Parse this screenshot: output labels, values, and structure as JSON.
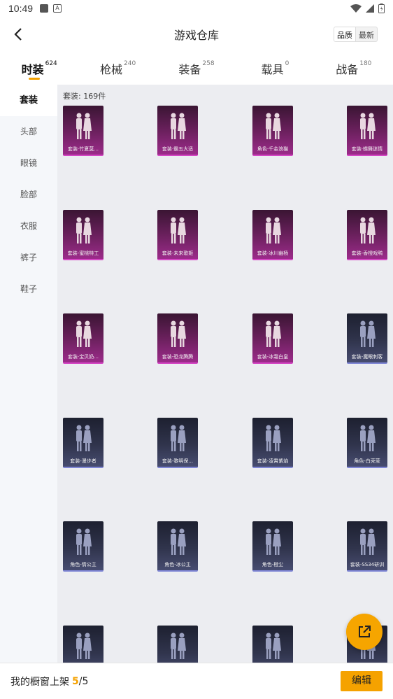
{
  "status_bar": {
    "time": "10:49",
    "icon_square": "square-icon",
    "icon_a": "A"
  },
  "nav": {
    "title": "游戏仓库",
    "sort_options": [
      "品质",
      "最新"
    ]
  },
  "tabs": [
    {
      "label": "时装",
      "count": "624"
    },
    {
      "label": "枪械",
      "count": "240"
    },
    {
      "label": "装备",
      "count": "258"
    },
    {
      "label": "载具",
      "count": "0"
    },
    {
      "label": "战备",
      "count": "180"
    }
  ],
  "sidebar": {
    "items": [
      "套装",
      "头部",
      "眼镜",
      "脸部",
      "衣服",
      "裤子",
      "鞋子"
    ]
  },
  "content": {
    "count_label": "套装: 169件",
    "items": [
      {
        "label": "套装·竹夏莫...",
        "tone": "purple"
      },
      {
        "label": "套装·霸五大适",
        "tone": "purple"
      },
      {
        "label": "角色·千金浪猫",
        "tone": "purple"
      },
      {
        "label": "套装·蝶舞迷情",
        "tone": "purple"
      },
      {
        "label": "套装-蜜桃特工",
        "tone": "purple"
      },
      {
        "label": "套装-未来歌姬",
        "tone": "purple"
      },
      {
        "label": "套装-冰川幽杨",
        "tone": "purple"
      },
      {
        "label": "套装-香橙戏鸭",
        "tone": "purple"
      },
      {
        "label": "套装·宝贝奶...",
        "tone": "purple"
      },
      {
        "label": "套装-恐龙腾腾",
        "tone": "purple"
      },
      {
        "label": "套装-冰霜白皇",
        "tone": "purple"
      },
      {
        "label": "套装-魔眼刺客",
        "tone": "dark"
      },
      {
        "label": "套装-漫步者",
        "tone": "dark"
      },
      {
        "label": "套装-黎明保...",
        "tone": "dark"
      },
      {
        "label": "套装-凌霄紫焰",
        "tone": "dark"
      },
      {
        "label": "角色-白壳莹",
        "tone": "dark"
      },
      {
        "label": "角色-情公主",
        "tone": "dark"
      },
      {
        "label": "角色-冰公主",
        "tone": "dark"
      },
      {
        "label": "角色-橙尘",
        "tone": "dark"
      },
      {
        "label": "套装-SS34研训",
        "tone": "dark"
      },
      {
        "label": "",
        "tone": "dark"
      },
      {
        "label": "",
        "tone": "dark"
      },
      {
        "label": "",
        "tone": "dark"
      },
      {
        "label": "",
        "tone": "dark"
      }
    ]
  },
  "fab": {
    "icon": "share-external-icon"
  },
  "bottom": {
    "label": "我的橱窗上架",
    "current": "5",
    "separator": "/",
    "max": "5",
    "edit_label": "编辑"
  },
  "colors": {
    "accent": "#f5a200",
    "purple_card": "#9c2b8a",
    "dark_card": "#474c70"
  }
}
